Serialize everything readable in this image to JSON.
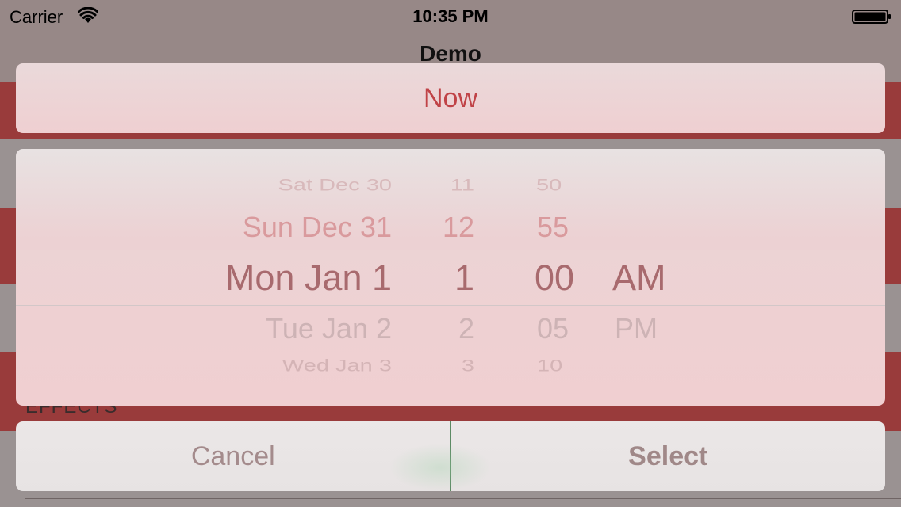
{
  "status_bar": {
    "carrier": "Carrier",
    "time": "10:35 PM",
    "wifi_icon": "wifi-icon",
    "battery_icon": "battery-icon"
  },
  "nav_bar": {
    "title": "Demo"
  },
  "background": {
    "section_label": "EFFECTS",
    "accent_red": "#993b3b",
    "dim_gray": "#9a9292"
  },
  "sheet": {
    "now_label": "Now",
    "cancel_label": "Cancel",
    "select_label": "Select",
    "accent_color": "#c04347"
  },
  "picker": {
    "date": {
      "far_above": "Sat Dec 30",
      "above": "Sun Dec 31",
      "selected": "Mon Jan 1",
      "below": "Tue Jan 2",
      "far_below": "Wed Jan 3"
    },
    "hour": {
      "far_above": "11",
      "above": "12",
      "selected": "1",
      "below": "2",
      "far_below": "3"
    },
    "minute": {
      "far_above": "50",
      "above": "55",
      "selected": "00",
      "below": "05",
      "far_below": "10"
    },
    "ampm": {
      "selected": "AM",
      "below": "PM"
    }
  }
}
